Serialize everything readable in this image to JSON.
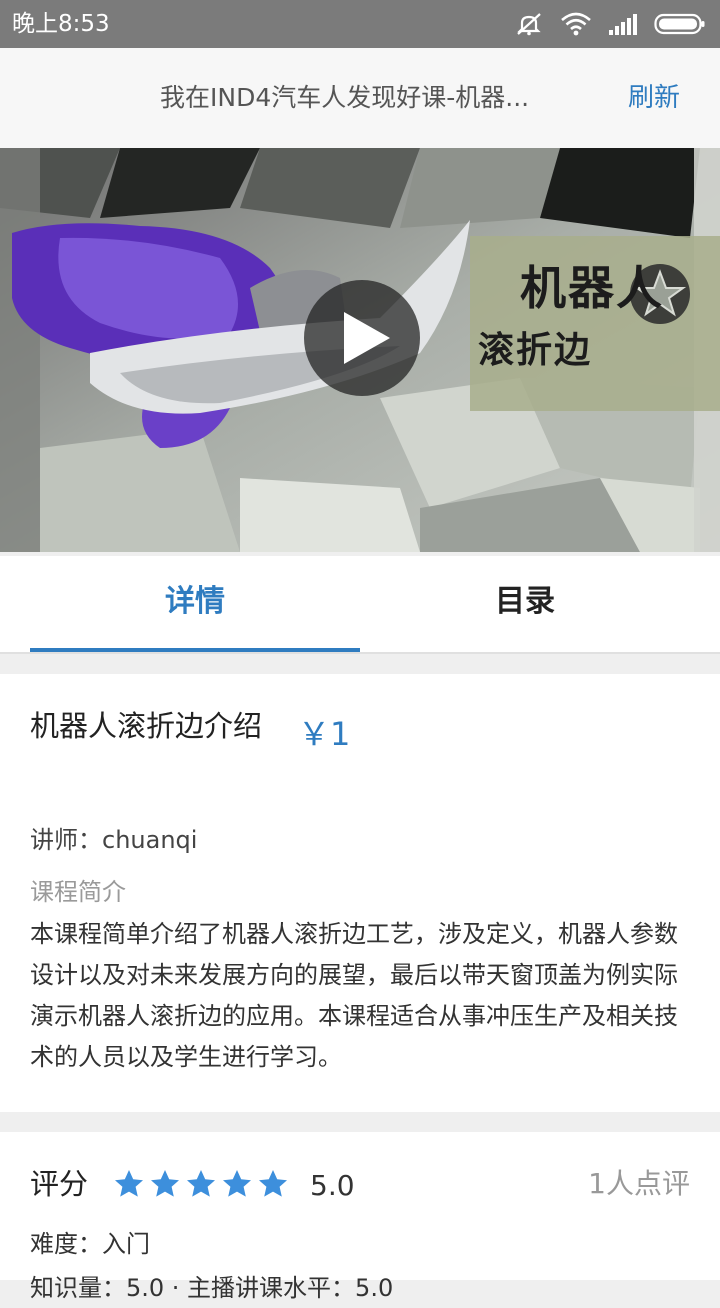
{
  "status_bar": {
    "time": "晚上8:53",
    "icons": [
      "mute-icon",
      "wifi-icon",
      "signal-icon",
      "battery-icon"
    ]
  },
  "header": {
    "title": "我在IND4汽车人发现好课-机器...",
    "refresh_label": "刷新"
  },
  "video": {
    "overlay_title_line1": "机器人",
    "overlay_title_line2": "滚折边",
    "play_icon": "play-icon"
  },
  "tabs": [
    {
      "label": "详情",
      "active": true
    },
    {
      "label": "目录",
      "active": false
    }
  ],
  "course": {
    "title": "机器人滚折边介绍",
    "price": "￥1",
    "teacher": "讲师：chuanqi",
    "intro_label": "课程简介",
    "intro_text": "本课程简单介绍了机器人滚折边工艺，涉及定义，机器人参数设计以及对未来发展方向的展望，最后以带天窗顶盖为例实际演示机器人滚折边的应用。本课程适合从事冲压生产及相关技术的人员以及学生进行学习。"
  },
  "rating": {
    "label": "评分",
    "stars": 5,
    "max_stars": 5,
    "value": "5.0",
    "review_count": "1人点评",
    "difficulty": "难度：入门",
    "next_line": "知识量：5.0 · 主播讲课水平：5.0"
  },
  "colors": {
    "accent": "#2f7cc0",
    "status_bar": "#7b7b7b",
    "star": "#3d8fdc"
  }
}
